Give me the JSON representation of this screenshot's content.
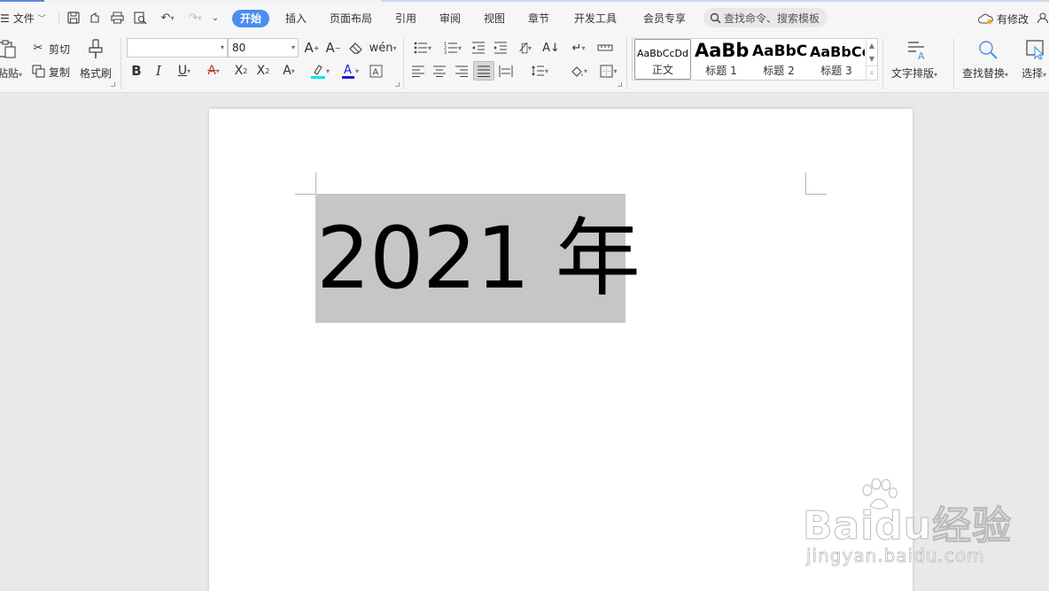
{
  "menubar": {
    "file_label": "文件",
    "tabs": [
      "开始",
      "插入",
      "页面布局",
      "引用",
      "审阅",
      "视图",
      "章节",
      "开发工具",
      "会员专享"
    ],
    "active_tab": "开始",
    "search_placeholder": "查找命令、搜索模板",
    "modified_label": "有修改"
  },
  "ribbon": {
    "paste_label": "粘贴",
    "cut_label": "剪切",
    "copy_label": "复制",
    "format_painter_label": "格式刷",
    "font_name": "",
    "font_size": "80",
    "styles": [
      {
        "preview": "AaBbCcDd",
        "label": "正文"
      },
      {
        "preview": "AaBb",
        "label": "标题 1"
      },
      {
        "preview": "AaBbC",
        "label": "标题 2"
      },
      {
        "preview": "AaBbCc",
        "label": "标题 3"
      }
    ],
    "text_layout_label": "文字排版",
    "find_replace_label": "查找替换",
    "select_label": "选择"
  },
  "document": {
    "text": "2021 年"
  },
  "watermark": {
    "brand": "Baidu经验",
    "url": "jingyan.baidu.com"
  },
  "colors": {
    "accent": "#4a8ef0",
    "highlight": "#00e5e5",
    "font_color": "#1a1acc",
    "selection": "#c6c6c6"
  }
}
